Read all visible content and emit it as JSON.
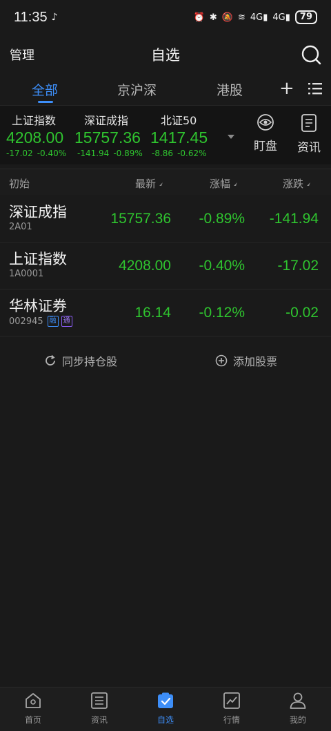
{
  "status_bar": {
    "time": "11:35",
    "battery": "79",
    "network_label_1": "4G",
    "network_label_2": "4G"
  },
  "header": {
    "manage_label": "管理",
    "title": "自选"
  },
  "tabs": [
    {
      "label": "全部",
      "active": true
    },
    {
      "label": "京沪深",
      "active": false
    },
    {
      "label": "港股",
      "active": false
    }
  ],
  "index_strip": [
    {
      "name": "上证指数",
      "value": "4208.00",
      "change": "-17.02",
      "pct": "-0.40%"
    },
    {
      "name": "深证成指",
      "value": "15757.36",
      "change": "-141.94",
      "pct": "-0.89%"
    },
    {
      "name": "北证50",
      "value": "1417.45",
      "change": "-8.86",
      "pct": "-0.62%"
    }
  ],
  "strip_buttons": {
    "watch_label": "盯盘",
    "news_label": "资讯"
  },
  "list_header": {
    "col_name": "初始",
    "col_last": "最新",
    "col_pct": "涨幅",
    "col_chg": "涨跌"
  },
  "rows": [
    {
      "name": "深证成指",
      "code": "2A01",
      "last": "15757.36",
      "pct": "-0.89%",
      "chg": "-141.94"
    },
    {
      "name": "上证指数",
      "code": "1A0001",
      "last": "4208.00",
      "pct": "-0.40%",
      "chg": "-17.02"
    },
    {
      "name": "华林证券",
      "code": "002945",
      "last": "16.14",
      "pct": "-0.12%",
      "chg": "-0.02",
      "badges": [
        "融",
        "通"
      ]
    }
  ],
  "actions": {
    "sync_label": "同步持仓股",
    "add_label": "添加股票"
  },
  "bottom_nav": [
    {
      "label": "首页",
      "icon": "home-icon"
    },
    {
      "label": "资讯",
      "icon": "news-icon"
    },
    {
      "label": "自选",
      "icon": "watchlist-icon",
      "active": true
    },
    {
      "label": "行情",
      "icon": "market-icon"
    },
    {
      "label": "我的",
      "icon": "profile-icon"
    }
  ],
  "colors": {
    "background": "#1a1a1a",
    "accent": "#3d8ef8",
    "down_green": "#2fc52f"
  }
}
